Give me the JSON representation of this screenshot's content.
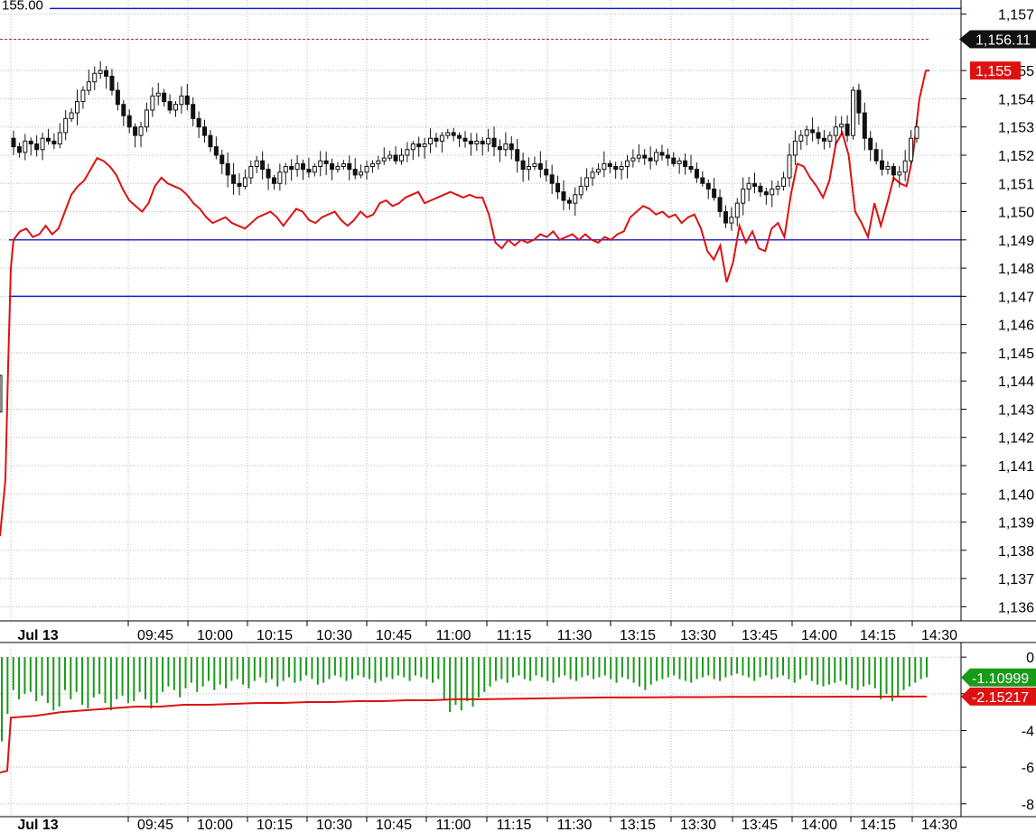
{
  "chart_data": [
    {
      "type": "candlestick",
      "title": "",
      "xlabel": "",
      "ylabel": "",
      "ylim": [
        1135.5,
        1157.5
      ],
      "y_ticks": [
        "1,157",
        "1,155",
        "1,154",
        "1,153",
        "1,152",
        "1,151",
        "1,150",
        "1,149",
        "1,148",
        "1,147",
        "1,146",
        "1,145",
        "1,144",
        "1,143",
        "1,142",
        "1,141",
        "1,140",
        "1,139",
        "1,138",
        "1,137",
        "1,136"
      ],
      "x_ticks": [
        "Jul 13",
        "09:45",
        "10:00",
        "10:15",
        "10:30",
        "10:45",
        "11:00",
        "11:15",
        "11:30",
        "13:15",
        "13:30",
        "13:45",
        "14:00",
        "14:15",
        "14:30"
      ],
      "grid": true,
      "horizontal_levels": [
        {
          "value": 1157.2,
          "label": "155.00",
          "color": "#1a1acc"
        },
        {
          "value": 1149.0,
          "label": "",
          "color": "#1a1acc"
        },
        {
          "value": 1147.0,
          "label": "",
          "color": "#1a1acc"
        }
      ],
      "dashed_level": {
        "value": 1156.11,
        "color": "#cc2222"
      },
      "price_badges": [
        {
          "label": "1,156.11",
          "value": 1156.11,
          "color": "#111111"
        },
        {
          "label": "1,155",
          "value": 1155.0,
          "color": "#dd1111"
        }
      ],
      "close_series": [
        1152.3,
        1152.1,
        1152.5,
        1152.4,
        1152.2,
        1152.6,
        1152.5,
        1152.4,
        1152.8,
        1153.3,
        1153.5,
        1153.9,
        1154.3,
        1154.6,
        1154.9,
        1155.0,
        1154.8,
        1154.3,
        1153.8,
        1153.4,
        1153.0,
        1152.7,
        1153.0,
        1153.6,
        1154.1,
        1154.2,
        1153.9,
        1153.6,
        1153.8,
        1154.1,
        1153.8,
        1153.3,
        1153.0,
        1152.7,
        1152.3,
        1152.0,
        1151.7,
        1151.3,
        1151.0,
        1150.9,
        1151.2,
        1151.6,
        1151.8,
        1151.5,
        1151.2,
        1151.0,
        1151.4,
        1151.6,
        1151.5,
        1151.7,
        1151.5,
        1151.4,
        1151.6,
        1151.8,
        1151.7,
        1151.5,
        1151.6,
        1151.7,
        1151.5,
        1151.3,
        1151.4,
        1151.6,
        1151.7,
        1151.8,
        1151.9,
        1152.0,
        1151.8,
        1152.0,
        1152.2,
        1152.4,
        1152.3,
        1152.4,
        1152.6,
        1152.5,
        1152.7,
        1152.8,
        1152.7,
        1152.6,
        1152.5,
        1152.4,
        1152.5,
        1152.4,
        1152.6,
        1152.3,
        1152.2,
        1152.4,
        1152.2,
        1151.8,
        1151.5,
        1151.6,
        1151.7,
        1151.5,
        1151.3,
        1151.0,
        1150.7,
        1150.4,
        1150.3,
        1150.6,
        1150.9,
        1151.2,
        1151.4,
        1151.5,
        1151.7,
        1151.6,
        1151.5,
        1151.6,
        1151.8,
        1151.9,
        1152.0,
        1151.9,
        1151.8,
        1152.1,
        1152.0,
        1151.9,
        1151.7,
        1151.8,
        1151.6,
        1151.5,
        1151.2,
        1151.0,
        1150.8,
        1150.5,
        1150.0,
        1149.6,
        1149.8,
        1150.3,
        1150.8,
        1151.0,
        1150.9,
        1150.7,
        1150.6,
        1150.8,
        1150.9,
        1151.2,
        1152.0,
        1152.5,
        1152.7,
        1152.9,
        1152.8,
        1152.6,
        1152.5,
        1152.7,
        1153.0,
        1153.1,
        1152.7,
        1154.3,
        1153.5,
        1152.6,
        1152.2,
        1151.8,
        1151.5,
        1151.6,
        1151.3,
        1151.4,
        1151.8,
        1152.6,
        1153.0
      ],
      "red_series": [
        1149.0,
        1149.3,
        1149.4,
        1149.1,
        1149.2,
        1149.5,
        1149.2,
        1149.4,
        1150.0,
        1150.6,
        1150.9,
        1151.1,
        1151.5,
        1151.9,
        1151.8,
        1151.6,
        1151.3,
        1150.8,
        1150.4,
        1150.2,
        1150.0,
        1150.3,
        1150.9,
        1151.2,
        1151.0,
        1150.9,
        1150.8,
        1150.6,
        1150.3,
        1150.1,
        1149.8,
        1149.6,
        1149.7,
        1149.8,
        1149.6,
        1149.5,
        1149.4,
        1149.6,
        1149.8,
        1149.9,
        1150.0,
        1149.8,
        1149.5,
        1149.8,
        1150.1,
        1150.0,
        1149.7,
        1149.6,
        1149.8,
        1149.9,
        1150.0,
        1149.7,
        1149.5,
        1149.7,
        1150.0,
        1149.8,
        1149.9,
        1150.3,
        1150.4,
        1150.2,
        1150.3,
        1150.5,
        1150.6,
        1150.7,
        1150.3,
        1150.4,
        1150.5,
        1150.6,
        1150.7,
        1150.6,
        1150.5,
        1150.6,
        1150.5,
        1150.5,
        1149.9,
        1148.9,
        1148.7,
        1149.0,
        1148.8,
        1149.0,
        1148.9,
        1149.0,
        1149.2,
        1149.1,
        1149.3,
        1149.0,
        1149.1,
        1149.2,
        1149.0,
        1149.2,
        1149.0,
        1148.9,
        1149.1,
        1149.0,
        1149.2,
        1149.3,
        1149.8,
        1150.0,
        1150.2,
        1150.1,
        1149.9,
        1150.0,
        1149.8,
        1149.9,
        1149.6,
        1149.8,
        1149.9,
        1149.4,
        1148.6,
        1148.3,
        1148.8,
        1147.5,
        1148.2,
        1149.5,
        1148.9,
        1149.3,
        1148.7,
        1148.6,
        1149.4,
        1149.6,
        1149.1,
        1150.6,
        1151.7,
        1151.6,
        1151.2,
        1150.9,
        1150.5,
        1151.1,
        1152.4,
        1152.8,
        1152.0,
        1150.0,
        1149.6,
        1149.1,
        1150.3,
        1149.5,
        1150.3,
        1151.2,
        1151.0,
        1150.9,
        1152.0,
        1154.0,
        1155.0
      ],
      "red_color": "#dd1111",
      "candle_color": "#111111"
    },
    {
      "type": "bar",
      "title": "",
      "ylim": [
        -8.7,
        0.6
      ],
      "y_ticks": [
        "0",
        "-2",
        "-4",
        "-6",
        "-8"
      ],
      "x_ticks": [
        "Jul 13",
        "09:45",
        "10:00",
        "10:15",
        "10:30",
        "10:45",
        "11:00",
        "11:15",
        "11:30",
        "13:15",
        "13:30",
        "13:45",
        "14:00",
        "14:15",
        "14:30"
      ],
      "bar_color": "#1a9a1a",
      "line_color": "#dd1111",
      "bar_values": [
        -4.6,
        -3.1,
        -1.8,
        -2.3,
        -2.0,
        -1.9,
        -2.4,
        -2.1,
        -2.5,
        -2.9,
        -2.7,
        -1.8,
        -2.3,
        -1.9,
        -2.6,
        -2.8,
        -2.2,
        -2.0,
        -2.5,
        -2.9,
        -2.3,
        -2.1,
        -2.5,
        -2.4,
        -1.9,
        -2.3,
        -2.8,
        -2.5,
        -1.9,
        -1.6,
        -1.8,
        -2.2,
        -1.7,
        -1.4,
        -1.9,
        -1.6,
        -1.3,
        -1.8,
        -1.5,
        -1.7,
        -1.3,
        -1.2,
        -1.5,
        -1.7,
        -1.3,
        -1.1,
        -1.4,
        -1.2,
        -1.6,
        -1.3,
        -1.1,
        -1.4,
        -1.3,
        -1.0,
        -1.2,
        -1.5,
        -1.4,
        -1.2,
        -1.0,
        -1.1,
        -1.3,
        -1.2,
        -1.0,
        -1.1,
        -1.2,
        -1.4,
        -1.3,
        -1.1,
        -1.2,
        -1.0,
        -1.1,
        -1.3,
        -1.0,
        -1.1,
        -1.2,
        -1.4,
        -1.2,
        -2.3,
        -3.0,
        -2.6,
        -2.9,
        -2.4,
        -2.7,
        -2.2,
        -1.9,
        -1.6,
        -1.3,
        -1.2,
        -1.4,
        -1.1,
        -1.0,
        -1.2,
        -1.3,
        -1.0,
        -1.1,
        -1.3,
        -1.4,
        -1.1,
        -1.0,
        -1.2,
        -1.3,
        -1.1,
        -1.0,
        -1.2,
        -1.1,
        -1.0,
        -1.2,
        -1.4,
        -1.1,
        -1.2,
        -1.4,
        -1.6,
        -1.8,
        -1.5,
        -1.3,
        -1.2,
        -1.1,
        -1.0,
        -1.2,
        -1.3,
        -1.4,
        -1.2,
        -1.1,
        -1.0,
        -1.2,
        -1.3,
        -1.1,
        -1.0,
        -0.9,
        -1.0,
        -1.1,
        -1.3,
        -1.1,
        -1.0,
        -1.2,
        -1.1,
        -1.0,
        -1.2,
        -1.4,
        -1.2,
        -1.0,
        -1.3,
        -1.5,
        -1.6,
        -1.5,
        -1.4,
        -1.3,
        -1.5,
        -1.7,
        -1.8,
        -1.6,
        -1.5,
        -1.7,
        -2.3,
        -2.0,
        -2.4,
        -2.2,
        -1.8,
        -1.6,
        -1.4,
        -1.2,
        -1.1
      ],
      "line_values": [
        -6.3,
        -3.2,
        -3.0,
        -2.9,
        -2.8,
        -2.7,
        -2.7,
        -2.6,
        -2.6,
        -2.55,
        -2.5,
        -2.5,
        -2.45,
        -2.45,
        -2.4,
        -2.4,
        -2.35,
        -2.35,
        -2.3,
        -2.3,
        -2.28,
        -2.26,
        -2.24,
        -2.22,
        -2.2,
        -2.2,
        -2.19,
        -2.18,
        -2.18,
        -2.17,
        -2.17,
        -2.16,
        -2.16,
        -2.16,
        -2.155,
        -2.155,
        -2.15,
        -2.15
      ],
      "badges": [
        {
          "label": "-1.10999",
          "value": -1.10999,
          "color": "#1a9a1a"
        },
        {
          "label": "-2.15217",
          "value": -2.15217,
          "color": "#dd1111"
        }
      ]
    }
  ]
}
